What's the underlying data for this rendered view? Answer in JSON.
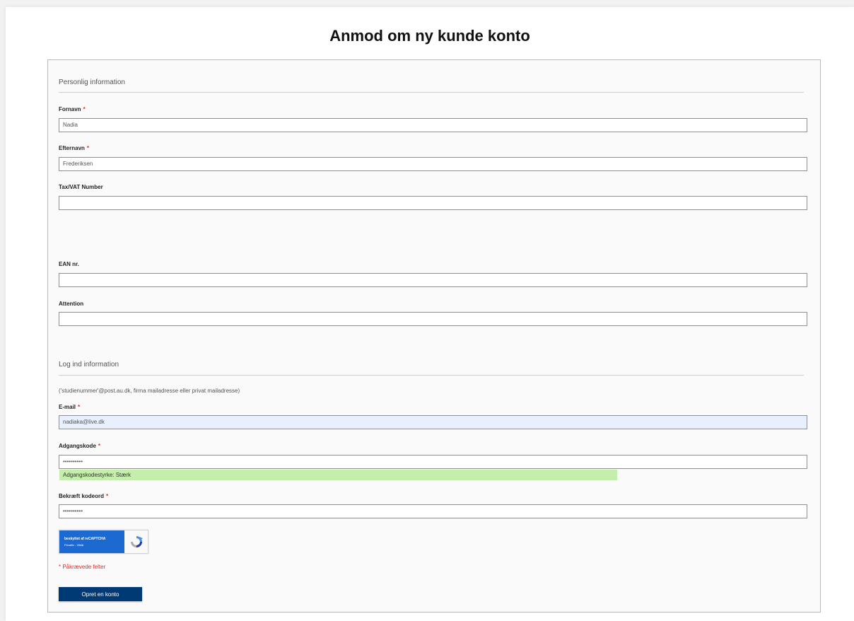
{
  "page": {
    "title": "Anmod om ny kunde konto"
  },
  "personal": {
    "section_title": "Personlig information",
    "firstname": {
      "label": "Fornavn",
      "required_mark": "*",
      "value": "Nadia"
    },
    "lastname": {
      "label": "Efternavn",
      "required_mark": "*",
      "value": "Frederiksen"
    },
    "vat": {
      "label": "Tax/VAT Number",
      "value": ""
    },
    "ean": {
      "label": "EAN nr.",
      "value": ""
    },
    "attention": {
      "label": "Attention",
      "value": ""
    }
  },
  "login": {
    "section_title": "Log ind information",
    "hint": "('studienummer'@post.au.dk, firma mailadresse eller privat mailadresse)",
    "email": {
      "label": "E-mail",
      "required_mark": "*",
      "value": "nadiaka@live.dk"
    },
    "password": {
      "label": "Adgangskode",
      "required_mark": "*",
      "value": "••••••••••"
    },
    "strength": {
      "text": "Adgangskodestyrke: Stærk",
      "level": 0.75,
      "color": "#c5eeac"
    },
    "confirm": {
      "label": "Bekræft kodeord",
      "required_mark": "*",
      "value": "••••••••••"
    }
  },
  "recaptcha": {
    "protected_text": "beskyttet af reCAPTCHA",
    "links_text": "Privatliv - Vilkår",
    "icon": "recaptcha-logo-icon",
    "color": "#1c6ad1"
  },
  "footer": {
    "required_note": "* Påkrævede felter",
    "submit_label": "Opret en konto",
    "button_color": "#003a74"
  }
}
